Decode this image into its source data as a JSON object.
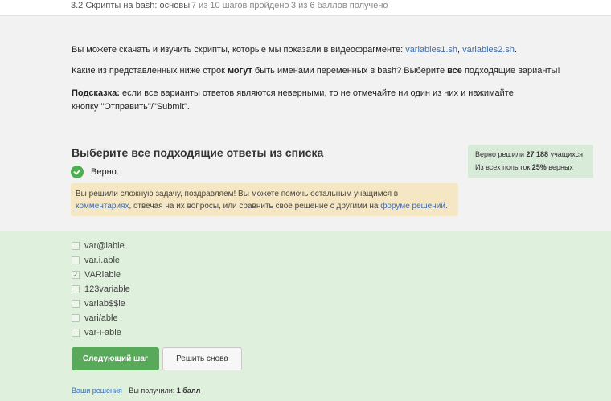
{
  "topbar": {
    "lesson": "3.2 Скрипты на bash: основы",
    "steps": "7 из 10 шагов пройдено",
    "points": "3 из 6 баллов  получено"
  },
  "intro": {
    "download_text": "Вы можете скачать и изучить скрипты, которые мы показали в видеофрагменте: ",
    "link1": "variables1.sh",
    "sep": ", ",
    "link2": "variables2.sh",
    "end": ".",
    "question_a": "Какие из представленных ниже строк ",
    "question_bold1": "могут",
    "question_b": " быть именами переменных в bash? Выберите ",
    "question_bold2": "все",
    "question_c": " подходящие варианты!",
    "hint_label": "Подсказка:",
    "hint_text": " если все варианты ответов являются неверными, то не отмечайте ни один из них и нажимайте кнопку \"Отправить\"/\"Submit\"."
  },
  "quiz": {
    "title": "Выберите все подходящие ответы из списка",
    "status": "Верно.",
    "feedback_a": "Вы решили сложную задачу, поздравляем! Вы можете помочь остальным учащимся в ",
    "feedback_link1": "комментариях",
    "feedback_b": ", отвечая на их вопросы, или сравнить своё решение с другими на ",
    "feedback_link2": "форуме решений",
    "feedback_c": "."
  },
  "stats": {
    "line1_a": "Верно решили ",
    "line1_num": "27 188",
    "line1_b": " учащихся",
    "line2_a": "Из всех попыток ",
    "line2_num": "25%",
    "line2_b": " верных"
  },
  "options": [
    {
      "label": "var@iable",
      "checked": false
    },
    {
      "label": "var.i.able",
      "checked": false
    },
    {
      "label": "VARiable",
      "checked": true
    },
    {
      "label": "123variable",
      "checked": false
    },
    {
      "label": "variab$$le",
      "checked": false
    },
    {
      "label": "vari/able",
      "checked": false
    },
    {
      "label": "var-i-able",
      "checked": false
    }
  ],
  "buttons": {
    "next": "Следующий шаг",
    "retry": "Решить снова"
  },
  "footer": {
    "your_solutions": "Ваши решения",
    "you_got": "Вы получили: ",
    "score": "1 балл"
  },
  "colors": {
    "accent_green": "#58a95a",
    "success_bg": "#dff0dc",
    "hint_bg": "#f6e7c4",
    "link": "#3a6fb5"
  }
}
